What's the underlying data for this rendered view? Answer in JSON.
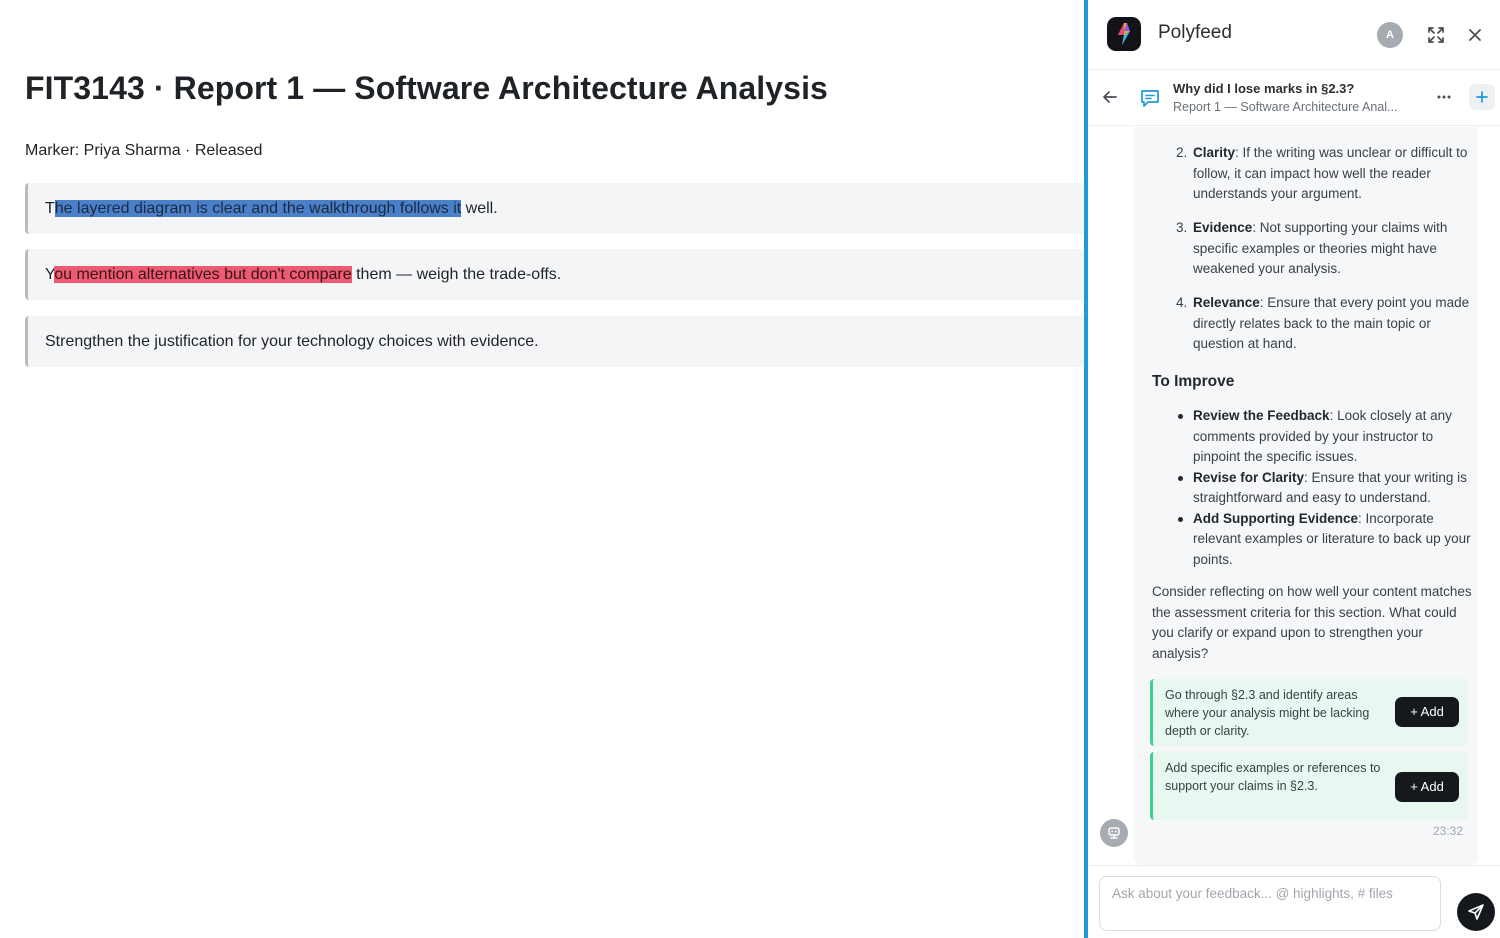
{
  "document": {
    "title": "FIT3143 · Report 1 — Software Architecture Analysis",
    "meta": "Marker: Priya Sharma · Released",
    "feedback": [
      {
        "pre": "T",
        "highlight": "he layered diagram is clear and the walkthrough follows it",
        "post": " well.",
        "highlight_color": "#4a7fc9"
      },
      {
        "pre": "Y",
        "highlight": "ou mention alternatives but don't compare",
        "post": " them — weigh the trade-offs.",
        "highlight_color": "#ec5b71"
      },
      {
        "text": "Strengthen the justification for your technology choices with evidence."
      }
    ]
  },
  "panel": {
    "brand": "Polyfeed",
    "avatar_initial": "A",
    "accent_color": "#1e9bd7",
    "icons": [
      "expand-icon",
      "close-icon",
      "back-arrow-icon",
      "chat-icon",
      "more-icon",
      "plus-icon",
      "bot-icon",
      "send-icon"
    ],
    "conversation": {
      "title": "Why did I lose marks in §2.3?",
      "subtitle": "Report 1 — Software Architecture Anal..."
    },
    "message": {
      "numbered": [
        {
          "num": "2.",
          "term": "Clarity",
          "text": ": If the writing was unclear or difficult to follow, it can impact how well the reader understands your argument."
        },
        {
          "num": "3.",
          "term": "Evidence",
          "text": ": Not supporting your claims with specific examples or theories might have weakened your analysis."
        },
        {
          "num": "4.",
          "term": "Relevance",
          "text": ": Ensure that every point you made directly relates back to the main topic or question at hand."
        }
      ],
      "improve_heading": "To Improve",
      "bullets": [
        {
          "term": "Review the Feedback",
          "text": ": Look closely at any comments provided by your instructor to pinpoint the specific issues."
        },
        {
          "term": "Revise for Clarity",
          "text": ": Ensure that your writing is straightforward and easy to understand."
        },
        {
          "term": "Add Supporting Evidence",
          "text": ": Incorporate relevant examples or literature to back up your points."
        }
      ],
      "closing": "Consider reflecting on how well your content matches the assessment criteria for this section. What could you clarify or expand upon to strengthen your analysis?",
      "suggestions": [
        {
          "text": "Go through §2.3 and identify areas where your analysis might be lacking depth or clarity.",
          "button": "+ Add"
        },
        {
          "text": "Add specific examples or references to support your claims in §2.3.",
          "button": "+ Add"
        }
      ],
      "timestamp": "23:32"
    },
    "composer": {
      "placeholder": "Ask about your feedback... @ highlights, # files",
      "value": ""
    }
  }
}
